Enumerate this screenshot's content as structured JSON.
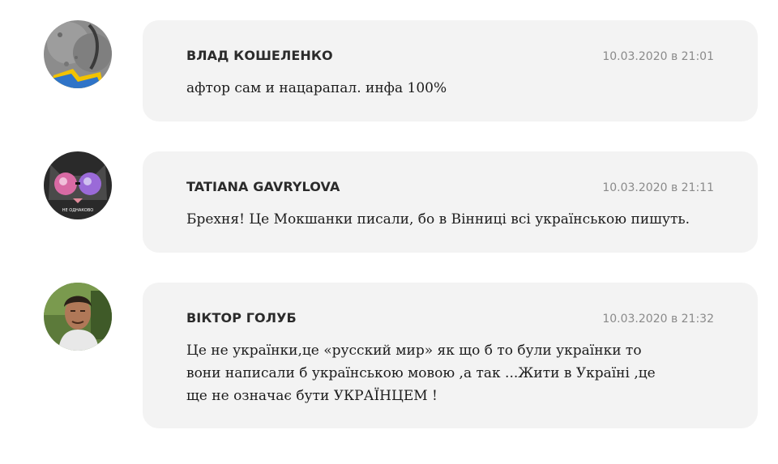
{
  "comments": [
    {
      "author": "ВЛАД КОШЕЛЕНКО",
      "timestamp": "10.03.2020 в 21:01",
      "text": "афтор сам и нацарапал. инфа 100%",
      "avatar_icon": "user-avatar-stone-flag"
    },
    {
      "author": "TATIANA GAVRYLOVA",
      "timestamp": "10.03.2020 в 21:11",
      "text": "Брехня! Це Мокшанки писали, бо в Вінниці всі українською пишуть.",
      "avatar_icon": "user-avatar-cat-sunglasses",
      "avatar_caption": "НЕ ОДНАКОВО"
    },
    {
      "author": "ВІКТОР ГОЛУБ",
      "timestamp": "10.03.2020 в 21:32",
      "text": "Це не українки,це «русский мир» як що б то були українки то вони написали б українською мовою ,а так ...Жити в Україні ,це ще не означає бути УКРАЇНЦЕМ !",
      "avatar_icon": "user-avatar-photo"
    }
  ],
  "colors": {
    "bubble_bg": "#f3f3f3",
    "author": "#2b2b2b",
    "timestamp": "#8a8a8a",
    "text": "#1c1c1c"
  }
}
